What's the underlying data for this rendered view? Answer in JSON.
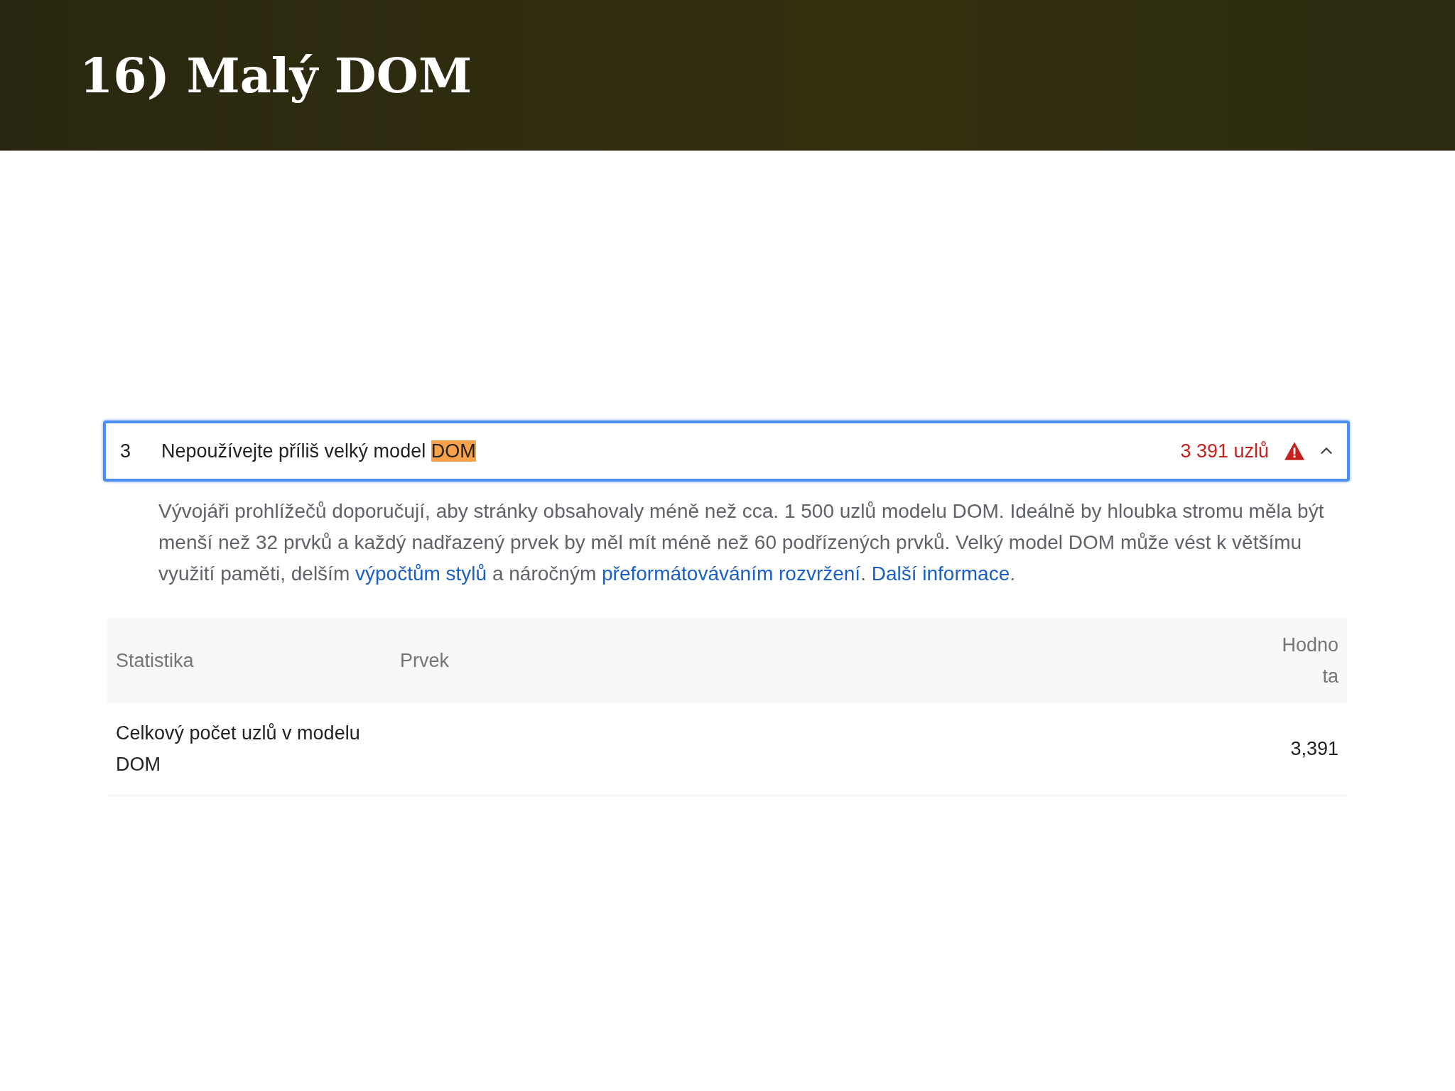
{
  "slide": {
    "title": "16) Malý DOM"
  },
  "audit": {
    "number": "3",
    "expanded": true,
    "title": [
      {
        "text": "Nepoužívejte příliš velký model ",
        "highlighted": false
      },
      {
        "text": "DOM",
        "highlighted": true
      }
    ],
    "display_value": "3 391 uzlů",
    "description": [
      {
        "text": "Vývojáři prohlížečů doporučují, aby stránky obsahovaly méně než cca. 1 500 uzlů modelu DOM. Ideálně by hloubka stromu měla být menší než 32 prvků a každý nadřazený prvek by měl mít méně než 60 podřízených prvků. Velký model DOM může vést k většímu využití paměti, delším ",
        "link": false
      },
      {
        "text": "výpočtům stylů",
        "link": true
      },
      {
        "text": " a náročným ",
        "link": false
      },
      {
        "text": "přeformátováváním rozvržení",
        "link": true
      },
      {
        "text": ". ",
        "link": false
      },
      {
        "text": "Další informace",
        "link": true
      },
      {
        "text": ".",
        "link": false
      }
    ],
    "table": {
      "columns": [
        "Statistika",
        "Prvek",
        "Hodnota"
      ],
      "rows": [
        [
          "Celkový počet uzlů v modelu DOM",
          "",
          "3,391"
        ]
      ]
    }
  }
}
